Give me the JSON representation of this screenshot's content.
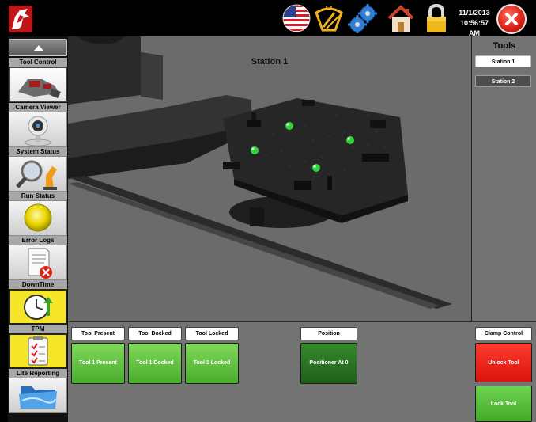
{
  "header": {
    "date": "11/1/2013",
    "time": "10:56:57 AM",
    "icons": [
      "logo-icon",
      "us-flag-icon",
      "windshield-wiper-icon",
      "gears-icon",
      "home-icon",
      "padlock-icon",
      "close-icon"
    ]
  },
  "sidebar": {
    "items": [
      {
        "label": "Tool Control",
        "icon": "robot-tool-icon"
      },
      {
        "label": "Camera Viewer",
        "icon": "webcam-icon"
      },
      {
        "label": "System Status",
        "icon": "magnifier-robot-icon"
      },
      {
        "label": "Run Status",
        "icon": "yellow-light-icon"
      },
      {
        "label": "Error Logs",
        "icon": "error-document-icon"
      },
      {
        "label": "DownTime",
        "icon": "clock-icon"
      },
      {
        "label": "TPM",
        "icon": "checklist-icon"
      },
      {
        "label": "Lite Reporting",
        "icon": "folder-icon"
      }
    ]
  },
  "viewport": {
    "title": "Station 1"
  },
  "tools": {
    "title": "Tools",
    "stations": [
      "Station 1",
      "Station 2"
    ],
    "selected": "Station 1"
  },
  "status": {
    "tool_present": {
      "label": "Tool Present",
      "value": "Tool 1 Present"
    },
    "tool_docked": {
      "label": "Tool Docked",
      "value": "Tool 1 Docked"
    },
    "tool_locked": {
      "label": "Tool Locked",
      "value": "Tool 1 Locked"
    },
    "position": {
      "label": "Position",
      "value": "Positioner At 0"
    }
  },
  "clamp": {
    "label": "Clamp Control",
    "unlock": "Unlock Tool",
    "lock": "Lock Tool"
  },
  "colors": {
    "status_green": "#5cc23b",
    "position_green": "#2a7423",
    "unlock_red": "#e8221a",
    "accent_yellow": "#f5e62a"
  }
}
